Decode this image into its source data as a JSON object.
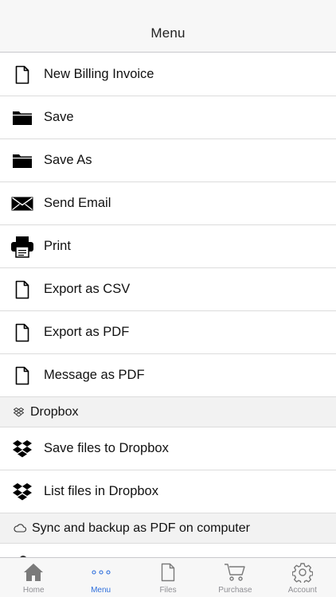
{
  "header": {
    "title": "Menu"
  },
  "menu": {
    "items": [
      {
        "label": "New Billing Invoice",
        "icon": "document-icon"
      },
      {
        "label": "Save",
        "icon": "folder-icon"
      },
      {
        "label": "Save As",
        "icon": "folder-icon"
      },
      {
        "label": "Send Email",
        "icon": "envelope-icon"
      },
      {
        "label": "Print",
        "icon": "printer-icon"
      },
      {
        "label": "Export as CSV",
        "icon": "document-icon"
      },
      {
        "label": "Export as PDF",
        "icon": "document-icon"
      },
      {
        "label": "Message as PDF",
        "icon": "document-icon"
      }
    ],
    "dropbox_section": {
      "title": "Dropbox",
      "icon": "dropbox-icon",
      "items": [
        {
          "label": "Save files to Dropbox",
          "icon": "dropbox-icon"
        },
        {
          "label": "List files in Dropbox",
          "icon": "dropbox-icon"
        }
      ]
    },
    "sync_section": {
      "title": "Sync and backup as PDF on computer",
      "icon": "cloud-icon"
    }
  },
  "tabbar": {
    "tabs": [
      {
        "label": "Home",
        "icon": "home-icon",
        "active": false
      },
      {
        "label": "Menu",
        "icon": "more-dots-icon",
        "active": true
      },
      {
        "label": "Files",
        "icon": "file-icon",
        "active": false
      },
      {
        "label": "Purchase",
        "icon": "cart-icon",
        "active": false
      },
      {
        "label": "Account",
        "icon": "gear-icon",
        "active": false
      }
    ]
  },
  "colors": {
    "accent": "#2f6fdc",
    "tab_inactive": "#8e8e93",
    "section_bg": "#f2f2f2"
  }
}
